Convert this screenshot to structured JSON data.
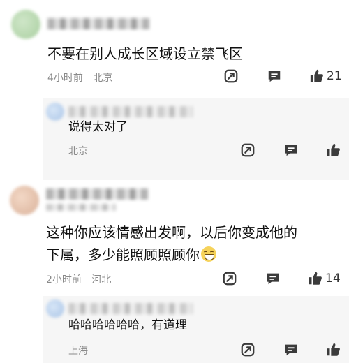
{
  "comments": [
    {
      "text": "不要在别人成长区域设立禁飞区",
      "time": "4小时前",
      "location": "北京",
      "likes": "21",
      "reply": {
        "text": "说得太对了",
        "location": "北京"
      }
    },
    {
      "text_line1": "这种你应该情感出发啊，以后你变成他的",
      "text_line2": "下属，多少能照顾照顾你",
      "time": "2小时前",
      "location": "河北",
      "likes": "14",
      "reply": {
        "text": "哈哈哈哈哈哈，有道理",
        "location": "上海"
      }
    }
  ],
  "icons": {
    "share": "share-icon",
    "comment": "comment-icon",
    "like": "thumbs-up-icon"
  },
  "colors": {
    "accent": "#3b3b3b",
    "meta": "#8a8a8a",
    "reply_bg": "#f6f6f6",
    "emoji": "#f6d35b"
  }
}
